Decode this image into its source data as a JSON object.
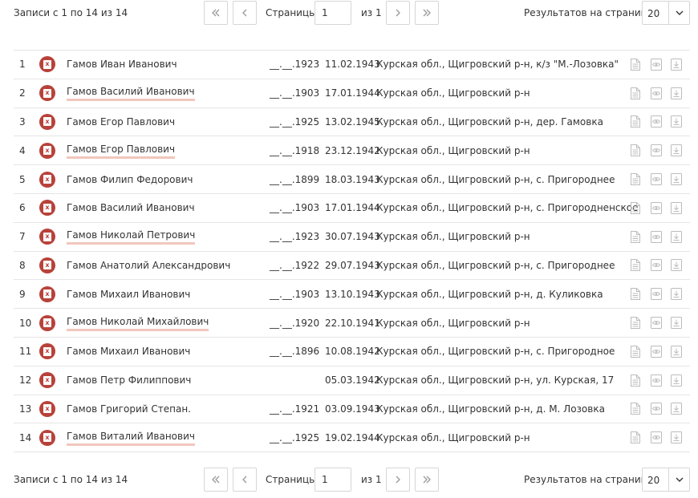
{
  "pager_top": {
    "records": "Записи с 1 по 14 из 14",
    "pages_label": "Страницы",
    "page_value": "1",
    "of_label": "из 1",
    "per_page_label": "Результатов на странице:",
    "per_page_value": "20"
  },
  "pager_bottom": {
    "records": "Записи с 1 по 14 из 14",
    "pages_label": "Страницы",
    "page_value": "1",
    "of_label": "из 1",
    "per_page_label": "Результатов на странице:",
    "per_page_value": "20"
  },
  "colors": {
    "badge": "#b8423a",
    "highlight": "#f1c7bd",
    "border": "#d6d6d6"
  },
  "rows": [
    {
      "num": "1",
      "name": "Гамов Иван Иванович",
      "birth": "__.__.1923",
      "death": "11.02.1943",
      "place": "Курская обл., Щигровский р-н, к/з \"М.-Лозовка\"",
      "highlight": false
    },
    {
      "num": "2",
      "name": "Гамов Василий Иванович",
      "birth": "__.__.1903",
      "death": "17.01.1944",
      "place": "Курская обл., Щигровский р-н",
      "highlight": true
    },
    {
      "num": "3",
      "name": "Гамов Егор Павлович",
      "birth": "__.__.1925",
      "death": "13.02.1945",
      "place": "Курская обл., Щигровский р-н, дер. Гамовка",
      "highlight": false
    },
    {
      "num": "4",
      "name": "Гамов Егор Павлович",
      "birth": "__.__.1918",
      "death": "23.12.1942",
      "place": "Курская обл., Щигровский р-н",
      "highlight": true
    },
    {
      "num": "5",
      "name": "Гамов Филип Федорович",
      "birth": "__.__.1899",
      "death": "18.03.1943",
      "place": "Курская обл., Щигровский р-н, с. Пригороднее",
      "highlight": false
    },
    {
      "num": "6",
      "name": "Гамов Василий Иванович",
      "birth": "__.__.1903",
      "death": "17.01.1944",
      "place": "Курская обл., Щигровский р-н, с. Пригородненское",
      "highlight": false
    },
    {
      "num": "7",
      "name": "Гамов Николай Петрович",
      "birth": "__.__.1923",
      "death": "30.07.1943",
      "place": "Курская обл., Щигровский р-н",
      "highlight": true
    },
    {
      "num": "8",
      "name": "Гамов Анатолий Александрович",
      "birth": "__.__.1922",
      "death": "29.07.1943",
      "place": "Курская обл., Щигровский р-н, с. Пригороднее",
      "highlight": false
    },
    {
      "num": "9",
      "name": "Гамов Михаил Иванович",
      "birth": "__.__.1903",
      "death": "13.10.1943",
      "place": "Курская обл., Щигровский р-н, д. Куликовка",
      "highlight": false
    },
    {
      "num": "10",
      "name": "Гамов Николай Михайлович",
      "birth": "__.__.1920",
      "death": "22.10.1941",
      "place": "Курская обл., Щигровский р-н",
      "highlight": true
    },
    {
      "num": "11",
      "name": "Гамов Михаил Иванович",
      "birth": "__.__.1896",
      "death": "10.08.1942",
      "place": "Курская обл., Щигровский р-н, с. Пригородное",
      "highlight": false
    },
    {
      "num": "12",
      "name": "Гамов Петр Филиппович",
      "birth": "",
      "death": "05.03.1942",
      "place": "Курская обл., Щигровский р-н, ул. Курская, 17",
      "highlight": false
    },
    {
      "num": "13",
      "name": "Гамов Григорий Степан.",
      "birth": "__.__.1921",
      "death": "03.09.1943",
      "place": "Курская обл., Щигровский р-н, д. М. Лозовка",
      "highlight": false
    },
    {
      "num": "14",
      "name": "Гамов Виталий Иванович",
      "birth": "__.__.1925",
      "death": "19.02.1944",
      "place": "Курская обл., Щигровский р-н",
      "highlight": true
    }
  ]
}
